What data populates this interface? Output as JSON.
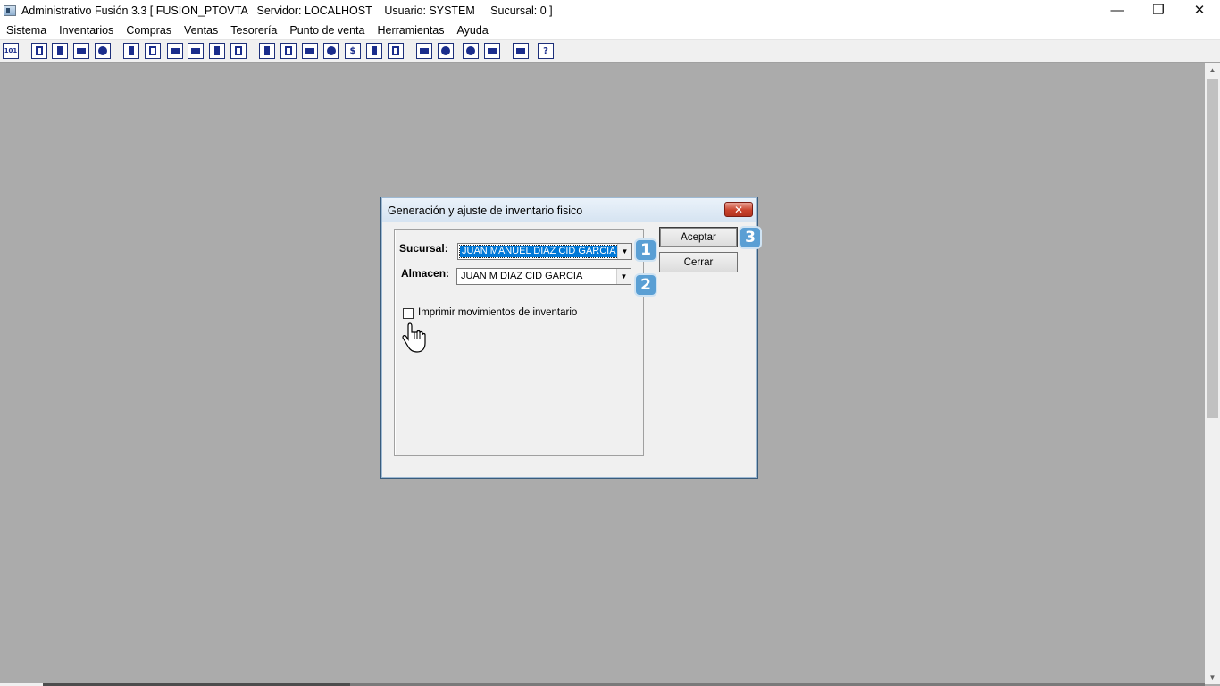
{
  "window": {
    "title": "Administrativo Fusión 3.3 [ FUSION_PTOVTA   Servidor: LOCALHOST    Usuario: SYSTEM     Sucursal: 0 ]",
    "controls": {
      "minimize": "—",
      "restore": "❐",
      "close": "✕"
    }
  },
  "menu": [
    "Sistema",
    "Inventarios",
    "Compras",
    "Ventas",
    "Tesorería",
    "Punto de venta",
    "Herramientas",
    "Ayuda"
  ],
  "toolbar": {
    "first_icon_text": "101",
    "dollar_icon_text": "$",
    "help_icon_text": "?"
  },
  "dialog": {
    "title": "Generación y ajuste de inventario fisico",
    "close_label": "✕",
    "sucursal_label": "Sucursal:",
    "sucursal_value": "JUAN MANUEL DIAZ CID GARCIA",
    "almacen_label": "Almacen:",
    "almacen_value": "JUAN M DIAZ CID GARCIA",
    "checkbox_label": "Imprimir movimientos de inventario",
    "checkbox_checked": false,
    "accept_label": "Aceptar",
    "close_button_label": "Cerrar"
  },
  "annotations": {
    "badge1": "1",
    "badge2": "2",
    "badge3": "3"
  },
  "colors": {
    "desktop": "#ababab",
    "badge": "#5a9fd4",
    "selection": "#0078d7"
  }
}
